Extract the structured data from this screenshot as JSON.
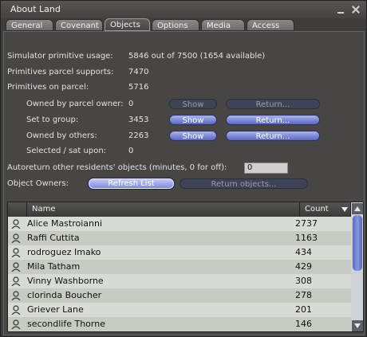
{
  "window": {
    "title": "About Land"
  },
  "tabs": [
    {
      "label": "General"
    },
    {
      "label": "Covenant"
    },
    {
      "label": "Objects"
    },
    {
      "label": "Options"
    },
    {
      "label": "Media"
    },
    {
      "label": "Access"
    }
  ],
  "active_tab": "Objects",
  "stats": {
    "sim_usage_label": "Simulator primitive usage:",
    "sim_usage_value": "5846 out of 7500 (1654 available)",
    "parcel_supports_label": "Primitives parcel supports:",
    "parcel_supports_value": "7470",
    "on_parcel_label": "Primitives on parcel:",
    "on_parcel_value": "5716"
  },
  "rows": {
    "owner": {
      "label": "Owned by parcel owner:",
      "value": "0",
      "show": "Show",
      "return": "Return..."
    },
    "group": {
      "label": "Set to group:",
      "value": "3453",
      "show": "Show",
      "return": "Return..."
    },
    "others": {
      "label": "Owned by others:",
      "value": "2263",
      "show": "Show",
      "return": "Return..."
    },
    "selected": {
      "label": "Selected / sat upon:",
      "value": "0"
    }
  },
  "autoreturn": {
    "label": "Autoreturn other residents' objects (minutes, 0 for off):",
    "value": "0"
  },
  "owners": {
    "label": "Object Owners:",
    "refresh": "Refresh List",
    "return_objects": "Return objects...",
    "col_name": "Name",
    "col_count": "Count",
    "items": [
      {
        "name": "Alice Mastroianni",
        "count": "2737"
      },
      {
        "name": "Raffi Cuttita",
        "count": "1163"
      },
      {
        "name": "rodroguez Imako",
        "count": "434"
      },
      {
        "name": "Mila Tatham",
        "count": "429"
      },
      {
        "name": "Vinny Washborne",
        "count": "308"
      },
      {
        "name": "clorinda Boucher",
        "count": "278"
      },
      {
        "name": "Griever Lane",
        "count": "201"
      },
      {
        "name": "secondlife Thorne",
        "count": "146"
      }
    ]
  },
  "icons": {
    "minimize": "minimize-icon",
    "close": "close-icon",
    "sort": "sort-desc-icon",
    "person": "person-icon",
    "scroll_up": "scroll-up-icon",
    "scroll_down": "scroll-down-icon"
  }
}
